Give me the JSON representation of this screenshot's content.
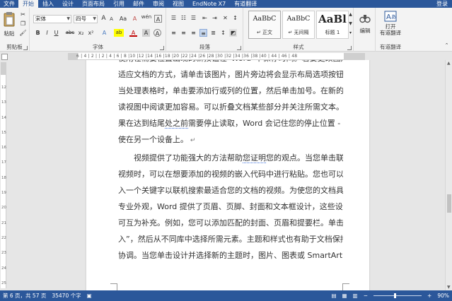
{
  "tabs": [
    "文件",
    "开始",
    "插入",
    "设计",
    "页面布局",
    "引用",
    "邮件",
    "审阅",
    "视图",
    "EndNote X7",
    "有道翻译"
  ],
  "active_tab": "开始",
  "login": "登录",
  "clipboard": {
    "paste": "粘贴",
    "label": "剪贴板"
  },
  "font": {
    "name": "宋体",
    "size": "四号",
    "grow": "A",
    "shrink": "A",
    "case": "Aa",
    "clear": "A",
    "wen": "wén",
    "box": "A",
    "bold": "B",
    "italic": "I",
    "underline": "U",
    "strike": "abc",
    "sub": "x₂",
    "sup": "x²",
    "effects": "A",
    "highlight": "ab",
    "color": "A",
    "shading": "A",
    "border_char": "A",
    "label": "字体"
  },
  "paragraph": {
    "label": "段落"
  },
  "styles": {
    "items": [
      {
        "sample": "AaBbC",
        "name": "↵ 正文"
      },
      {
        "sample": "AaBbC",
        "name": "↵ 无间隔"
      },
      {
        "sample": "AaBl",
        "name": "标题 1"
      }
    ],
    "label": "样式"
  },
  "editing": {
    "label": "编辑"
  },
  "youdao": {
    "button1": "打开",
    "button2": "有道翻译",
    "label": "有道翻译"
  },
  "ruler_ticks": "6 | 4 | 2 | | 2 | 4 | 6 | 8 |10 |12 |14 |16 |18 |20 |22 |24 |26 |28 |30 |32 |34 |36 |38 |40 |  44 | 46 | 48",
  "vruler_ticks": [
    "12",
    "13",
    "14",
    "15",
    "16",
    "17",
    "18",
    "19",
    "20",
    "21",
    "22",
    "23",
    "24",
    "25"
  ],
  "document": {
    "lines": [
      "使用在需要位置出现的新按钮在“Word”中保存时间。若要更改图片",
      "适应文档的方式，请单击该图片，图片旁边将会显示布局选项按钮。",
      "当处理表格时，单击要添加行或列的位置，然后单击加号。在新的阅",
      "读视图中阅读更加容易。可以折叠文档某些部分并关注所需文本。如",
      [
        "果在达到结尾",
        "处之前",
        "需要停止读取，Word 会记住您的停止位置 - 即"
      ],
      "使在另一个设备上。",
      [
        "　　视频提供了功能强大的方法帮助",
        "您证明",
        "您的观点。当您单击联机"
      ],
      "视频时，可以在想要添加的视频的嵌入代码中进行粘贴。您也可以键",
      "入一个关键字以联机搜索最适合您的文档的视频。为使您的文档具有",
      "专业外观，Word 提供了页眉、页脚、封面和文本框设计，这些设计",
      "可互为补充。例如，您可以添加匹配的封面、页眉和提要栏。单击“插",
      "入”，然后从不同库中选择所需元素。主题和样式也有助于文档保持",
      "协调。当您单击设计并选择新的主题时，图片、图表或 SmartArt 图"
    ]
  },
  "status": {
    "page": "第 6 页，共 57 页",
    "words": "35470 个字",
    "zoom": "90%",
    "zoom_level": 0.45
  }
}
